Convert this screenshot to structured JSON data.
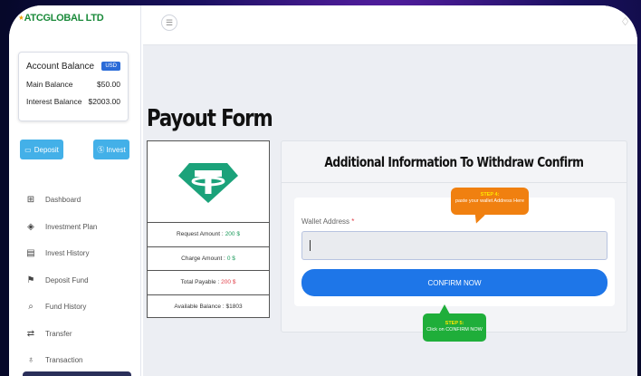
{
  "brand": {
    "logo_text": "ATCGLOBAL LTD",
    "logo_mark": "⋆"
  },
  "account": {
    "title": "Account Balance",
    "currency_badge": "USD",
    "rows": [
      {
        "label": "Main Balance",
        "value": "$50.00"
      },
      {
        "label": "Interest Balance",
        "value": "$2003.00"
      }
    ]
  },
  "actions": {
    "deposit": "Deposit",
    "invest": "Invest"
  },
  "sidebar": {
    "items": [
      {
        "label": "Dashboard",
        "icon": "⊞",
        "icon_name": "dashboard-icon"
      },
      {
        "label": "Investment Plan",
        "icon": "◈",
        "icon_name": "layers-icon"
      },
      {
        "label": "Invest History",
        "icon": "▤",
        "icon_name": "document-icon"
      },
      {
        "label": "Deposit Fund",
        "icon": "⚑",
        "icon_name": "deposit-icon"
      },
      {
        "label": "Fund History",
        "icon": "⌕",
        "icon_name": "search-icon"
      },
      {
        "label": "Transfer",
        "icon": "⇄",
        "icon_name": "transfer-icon"
      },
      {
        "label": "Transaction",
        "icon": "♁",
        "icon_name": "transaction-icon"
      }
    ]
  },
  "page": {
    "title": "Payout Form"
  },
  "payout": {
    "rows": [
      {
        "label": "Request Amount :",
        "value": "200 $",
        "tone": "green"
      },
      {
        "label": "Charge Amount :",
        "value": "0 $",
        "tone": "green"
      },
      {
        "label": "Total Payable :",
        "value": "200 $",
        "tone": "red"
      },
      {
        "label": "Available Balance :",
        "value": "$1803",
        "tone": "dark"
      }
    ]
  },
  "form": {
    "header": "Additional Information To Withdraw Confirm",
    "wallet_label": "Wallet Address",
    "required_mark": "*",
    "confirm_label": "CONFIRM NOW"
  },
  "callouts": {
    "step4_title": "STEP 4:",
    "step4_text": "paste your wallet Address Here",
    "step5_title": "STEP 5:",
    "step5_text": "Click on CONFIRM NOW"
  },
  "colors": {
    "accent_blue": "#1e76e8",
    "tether_green": "#1ba27a",
    "callout_orange": "#f08010",
    "callout_green": "#1fae3a"
  }
}
